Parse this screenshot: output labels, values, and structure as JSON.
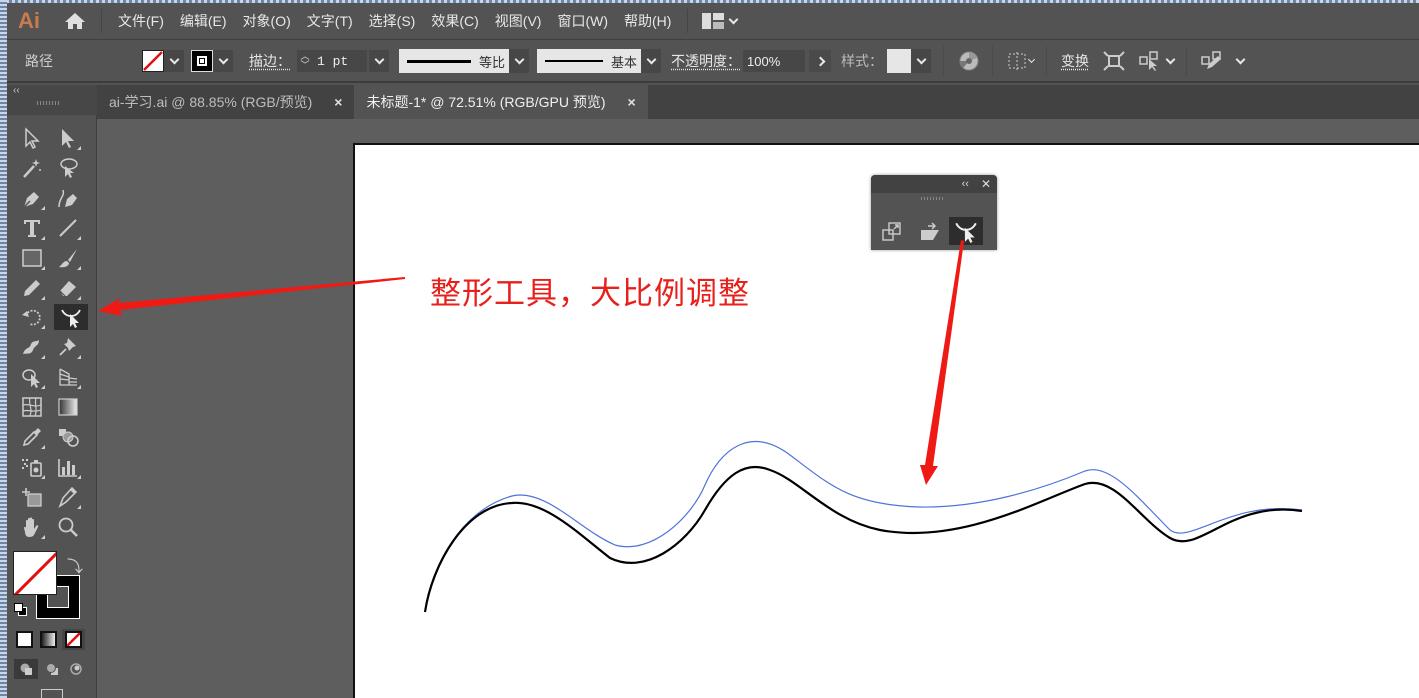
{
  "app": {
    "logo": "Ai",
    "menu": [
      "文件(F)",
      "编辑(E)",
      "对象(O)",
      "文字(T)",
      "选择(S)",
      "效果(C)",
      "视图(V)",
      "窗口(W)",
      "帮助(H)"
    ]
  },
  "control_bar": {
    "selection_type": "路径",
    "stroke_label": "描边：",
    "stroke_weight": "1 pt",
    "variable_width_profile": "等比",
    "brush_definition": "基本",
    "opacity_label": "不透明度：",
    "opacity_value": "100%",
    "style_label": "样式：",
    "transform_label": "变换",
    "fill_color": "none",
    "stroke_color": "#000000"
  },
  "tabs": [
    {
      "label": "ai-学习.ai @ 88.85% (RGB/预览)",
      "active": false,
      "close": "×"
    },
    {
      "label": "未标题-1* @ 72.51% (RGB/GPU 预览)",
      "active": true,
      "close": "×"
    }
  ],
  "toolbar": {
    "collapse": "‹‹",
    "tools": [
      "selection-tool",
      "direct-selection-tool",
      "magic-wand-tool",
      "lasso-tool",
      "pen-tool",
      "curvature-tool",
      "type-tool",
      "line-segment-tool",
      "rectangle-tool",
      "paintbrush-tool",
      "pencil-tool",
      "eraser-tool",
      "rotate-tool",
      "reshape-tool",
      "width-tool",
      "puppet-warp-tool",
      "shape-builder-tool",
      "perspective-grid-tool",
      "mesh-tool",
      "gradient-tool",
      "eyedropper-tool",
      "blend-tool",
      "symbol-sprayer-tool",
      "column-graph-tool",
      "artboard-tool",
      "slice-tool",
      "hand-tool",
      "zoom-tool"
    ],
    "selected_tool": "reshape-tool"
  },
  "float_panel": {
    "collapse": "‹‹",
    "close": "✕",
    "buttons": [
      "scale-tool",
      "shear-tool",
      "reshape-tool"
    ],
    "selected": "reshape-tool"
  },
  "annotation": {
    "text": "整形工具，大比例调整",
    "color": "#e8201c"
  },
  "colors": {
    "original_path": "#000000",
    "preview_path": "#4f74d8",
    "arrow": "#f01a14"
  }
}
